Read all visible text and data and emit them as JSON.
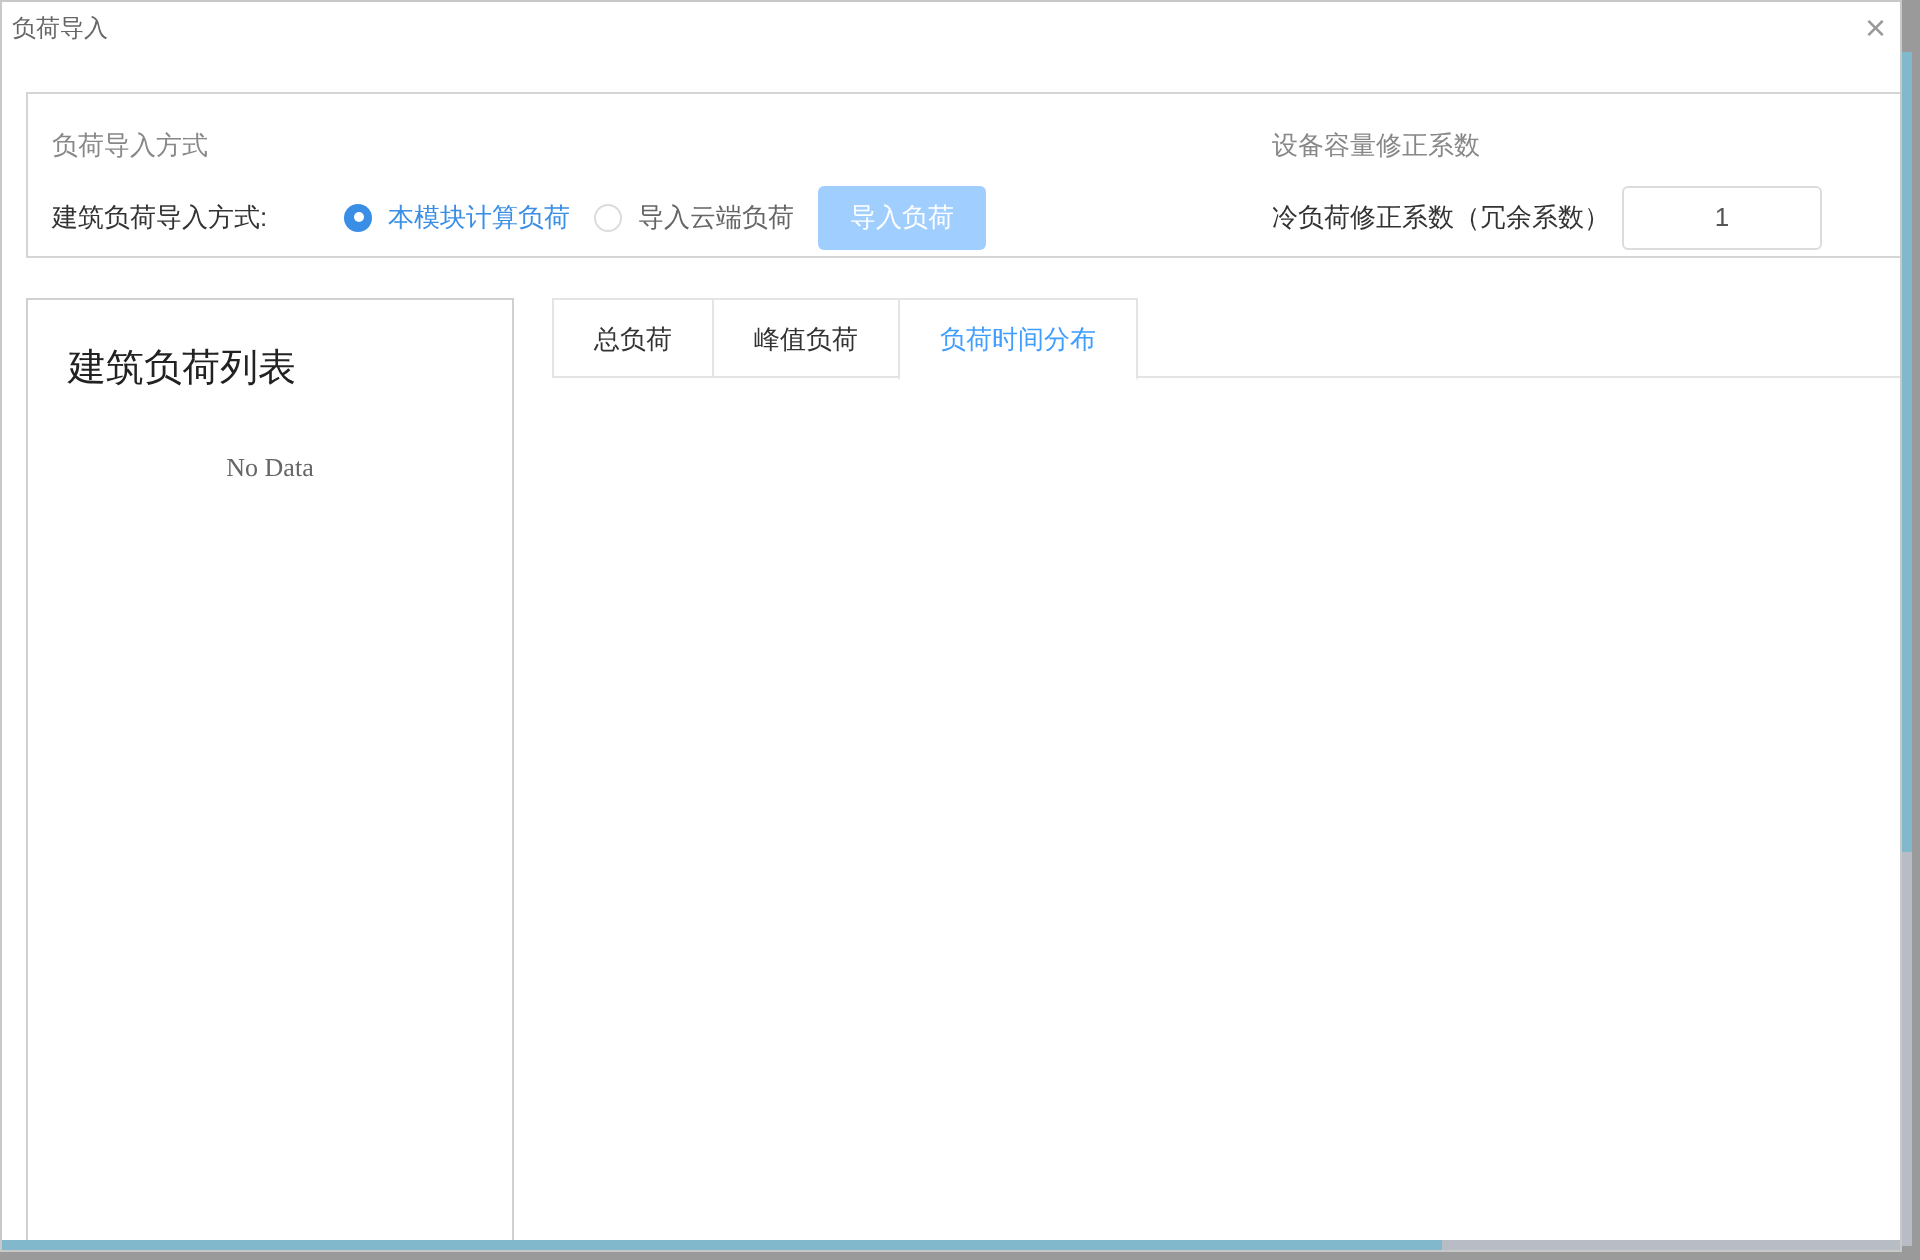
{
  "window": {
    "title": "负荷导入",
    "close": "×"
  },
  "import_method": {
    "heading": "负荷导入方式",
    "label": "建筑负荷导入方式:",
    "options": [
      {
        "label": "本模块计算负荷",
        "selected": true
      },
      {
        "label": "导入云端负荷",
        "selected": false
      }
    ],
    "button": {
      "label": "导入负荷",
      "disabled": true
    }
  },
  "capacity": {
    "heading": "设备容量修正系数",
    "label": "冷负荷修正系数（冗余系数）",
    "value": "1"
  },
  "building_list": {
    "title": "建筑负荷列表",
    "empty": "No Data"
  },
  "tabs": [
    {
      "label": "总负荷",
      "selected": false
    },
    {
      "label": "峰值负荷",
      "selected": false
    },
    {
      "label": "负荷时间分布",
      "selected": true
    }
  ]
}
